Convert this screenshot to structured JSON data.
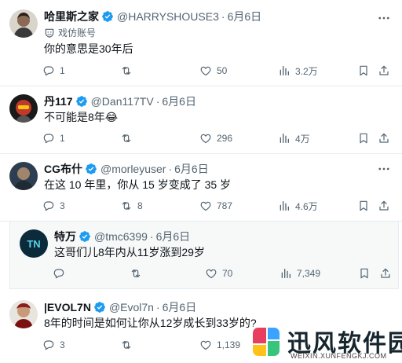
{
  "tweets": [
    {
      "name": "哈里斯之家",
      "handle": "@HARRYSHOUSE3",
      "dot": "·",
      "date": "6月6日",
      "badge": "戏仿账号",
      "text": "你的意思是30年后",
      "replies": "1",
      "retweets": "",
      "likes": "50",
      "views": "3.2万"
    },
    {
      "name": "丹117",
      "handle": "@Dan117TV",
      "dot": "·",
      "date": "6月6日",
      "text": "不可能是8年😂",
      "replies": "1",
      "retweets": "",
      "likes": "296",
      "views": "4万"
    },
    {
      "name": "CG布什",
      "handle": "@morleyuser",
      "dot": "·",
      "date": "6月6日",
      "text": "在这 10 年里，你从 15 岁变成了 35 岁",
      "replies": "3",
      "retweets": "8",
      "likes": "787",
      "views": "4.6万"
    },
    {
      "name": "特万",
      "handle": "@tmc6399",
      "dot": "·",
      "date": "6月6日",
      "text": "这哥们儿8年内从11岁涨到29岁",
      "replies": "",
      "retweets": "",
      "likes": "70",
      "views": "7,349"
    },
    {
      "name": "|EVOL7N",
      "handle": "@Evol7n",
      "dot": "·",
      "date": "6月6日",
      "text": "8年的时间是如何让你从12岁成长到33岁的?",
      "replies": "3",
      "retweets": "",
      "likes": "1,139",
      "views": ""
    }
  ],
  "avatar_labels": {
    "tmc": "TN"
  },
  "watermark": {
    "title": "迅风软件园",
    "url": "WEIXIN.XUNFENGKJ.COM"
  },
  "colors": {
    "verified": "#1d9bf0",
    "muted": "#536471",
    "text": "#0f1419",
    "divider": "#e6ecf0"
  }
}
